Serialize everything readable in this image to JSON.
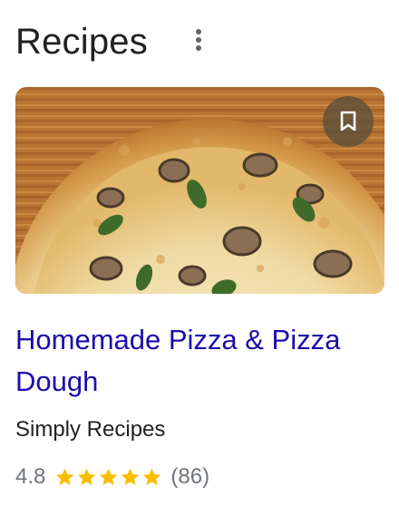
{
  "header": {
    "title": "Recipes",
    "more_icon": "more-vert-icon"
  },
  "card": {
    "image_alt": "pizza-photo",
    "save_icon": "bookmark-icon",
    "title": "Homemade Pizza & Pizza Dough",
    "source": "Simply Recipes",
    "rating": "4.8",
    "stars": 5,
    "reviews": "(86)"
  },
  "colors": {
    "link": "#1a0dab",
    "text": "#202124",
    "muted": "#70757a",
    "star": "#fbbc04"
  }
}
